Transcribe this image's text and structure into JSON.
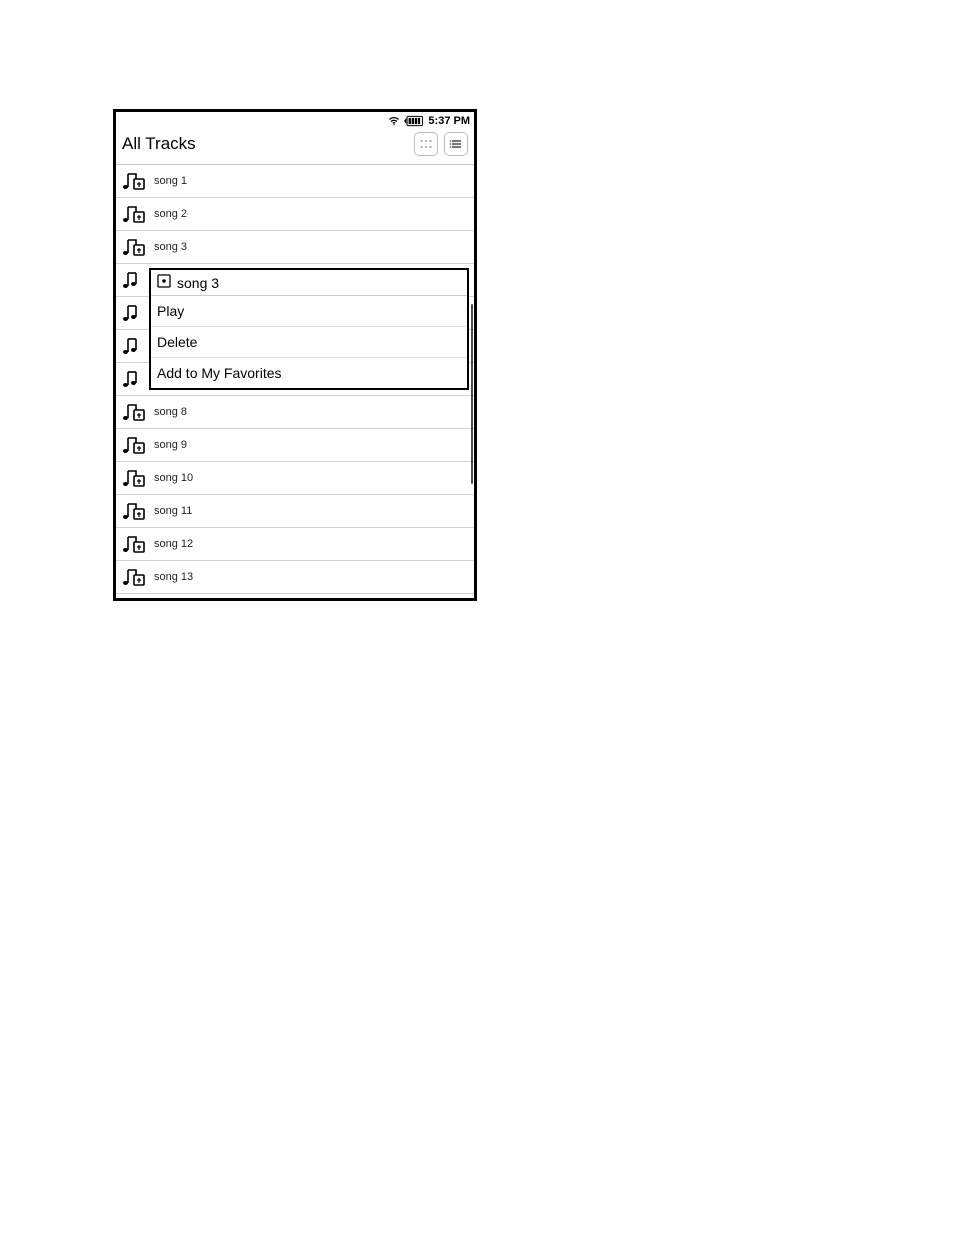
{
  "status": {
    "time": "5:37 PM"
  },
  "header": {
    "title": "All Tracks"
  },
  "tracks": [
    {
      "label": "song 1"
    },
    {
      "label": "song 2"
    },
    {
      "label": "song 3"
    },
    {
      "label": ""
    },
    {
      "label": ""
    },
    {
      "label": ""
    },
    {
      "label": ""
    },
    {
      "label": "song 8"
    },
    {
      "label": "song 9"
    },
    {
      "label": "song 10"
    },
    {
      "label": "song 11"
    },
    {
      "label": "song 12"
    },
    {
      "label": "song 13"
    }
  ],
  "context_menu": {
    "title": "song 3",
    "items": [
      {
        "label": "Play"
      },
      {
        "label": "Delete"
      },
      {
        "label": "Add to My Favorites"
      }
    ]
  }
}
